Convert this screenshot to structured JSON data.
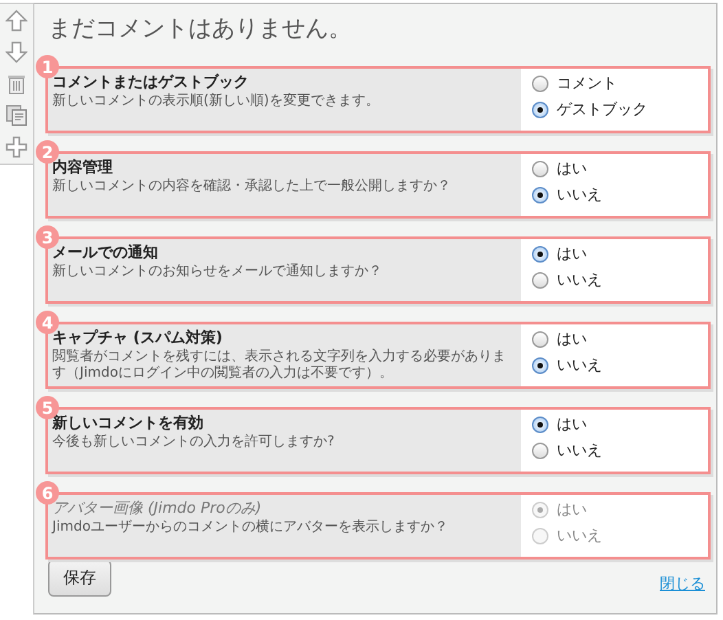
{
  "title": "まだコメントはありません。",
  "settings": [
    {
      "badge": "1",
      "title": "コメントまたはゲストブック",
      "description": "新しいコメントの表示順(新しい順)を変更できます。",
      "disabled": false,
      "options": [
        {
          "label": "コメント",
          "selected": false
        },
        {
          "label": "ゲストブック",
          "selected": true
        }
      ]
    },
    {
      "badge": "2",
      "title": "内容管理",
      "description": "新しいコメントの内容を確認・承認した上で一般公開しますか？",
      "disabled": false,
      "options": [
        {
          "label": "はい",
          "selected": false
        },
        {
          "label": "いいえ",
          "selected": true
        }
      ]
    },
    {
      "badge": "3",
      "title": "メールでの通知",
      "description": "新しいコメントのお知らせをメールで通知しますか？",
      "disabled": false,
      "options": [
        {
          "label": "はい",
          "selected": true
        },
        {
          "label": "いいえ",
          "selected": false
        }
      ]
    },
    {
      "badge": "4",
      "title": "キャプチャ (スパム対策)",
      "description": "閲覧者がコメントを残すには、表示される文字列を入力する必要があります（Jimdoにログイン中の閲覧者の入力は不要です）。",
      "disabled": false,
      "options": [
        {
          "label": "はい",
          "selected": false
        },
        {
          "label": "いいえ",
          "selected": true
        }
      ]
    },
    {
      "badge": "5",
      "title": "新しいコメントを有効",
      "description": "今後も新しいコメントの入力を許可しますか?",
      "disabled": false,
      "options": [
        {
          "label": "はい",
          "selected": true
        },
        {
          "label": "いいえ",
          "selected": false
        }
      ]
    },
    {
      "badge": "6",
      "title": "アバター画像 (Jimdo Proのみ)",
      "description": "Jimdoユーザーからのコメントの横にアバターを表示しますか？",
      "disabled": true,
      "options": [
        {
          "label": "はい",
          "selected": true
        },
        {
          "label": "いいえ",
          "selected": false
        }
      ]
    }
  ],
  "save_button": "保存",
  "close_link": "閉じる"
}
